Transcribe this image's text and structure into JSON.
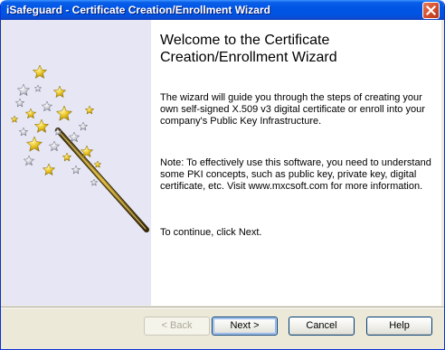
{
  "window": {
    "title": "iSafeguard - Certificate Creation/Enrollment Wizard"
  },
  "side_panel": {
    "graphic": "magic-wand-with-stars",
    "background_color": "#e6e6f5"
  },
  "main": {
    "heading": "Welcome to the Certificate Creation/Enrollment Wizard",
    "paragraphs": [
      "The wizard will guide you through the steps of creating your own self-signed X.509 v3 digital certificate or enroll into your company's Public Key Infrastructure.",
      "Note: To effectively use this software, you need to understand some PKI concepts, such as public key, private key, digital certificate, etc.  Visit www.mxcsoft.com for more information.",
      "To continue, click Next."
    ]
  },
  "buttons": {
    "back": "< Back",
    "next": "Next >",
    "cancel": "Cancel",
    "help": "Help"
  },
  "colors": {
    "titlebar": "#0054e3",
    "dialog_face": "#ece9d8",
    "close_button": "#d6502e",
    "star_gold": "#e8c21a"
  }
}
